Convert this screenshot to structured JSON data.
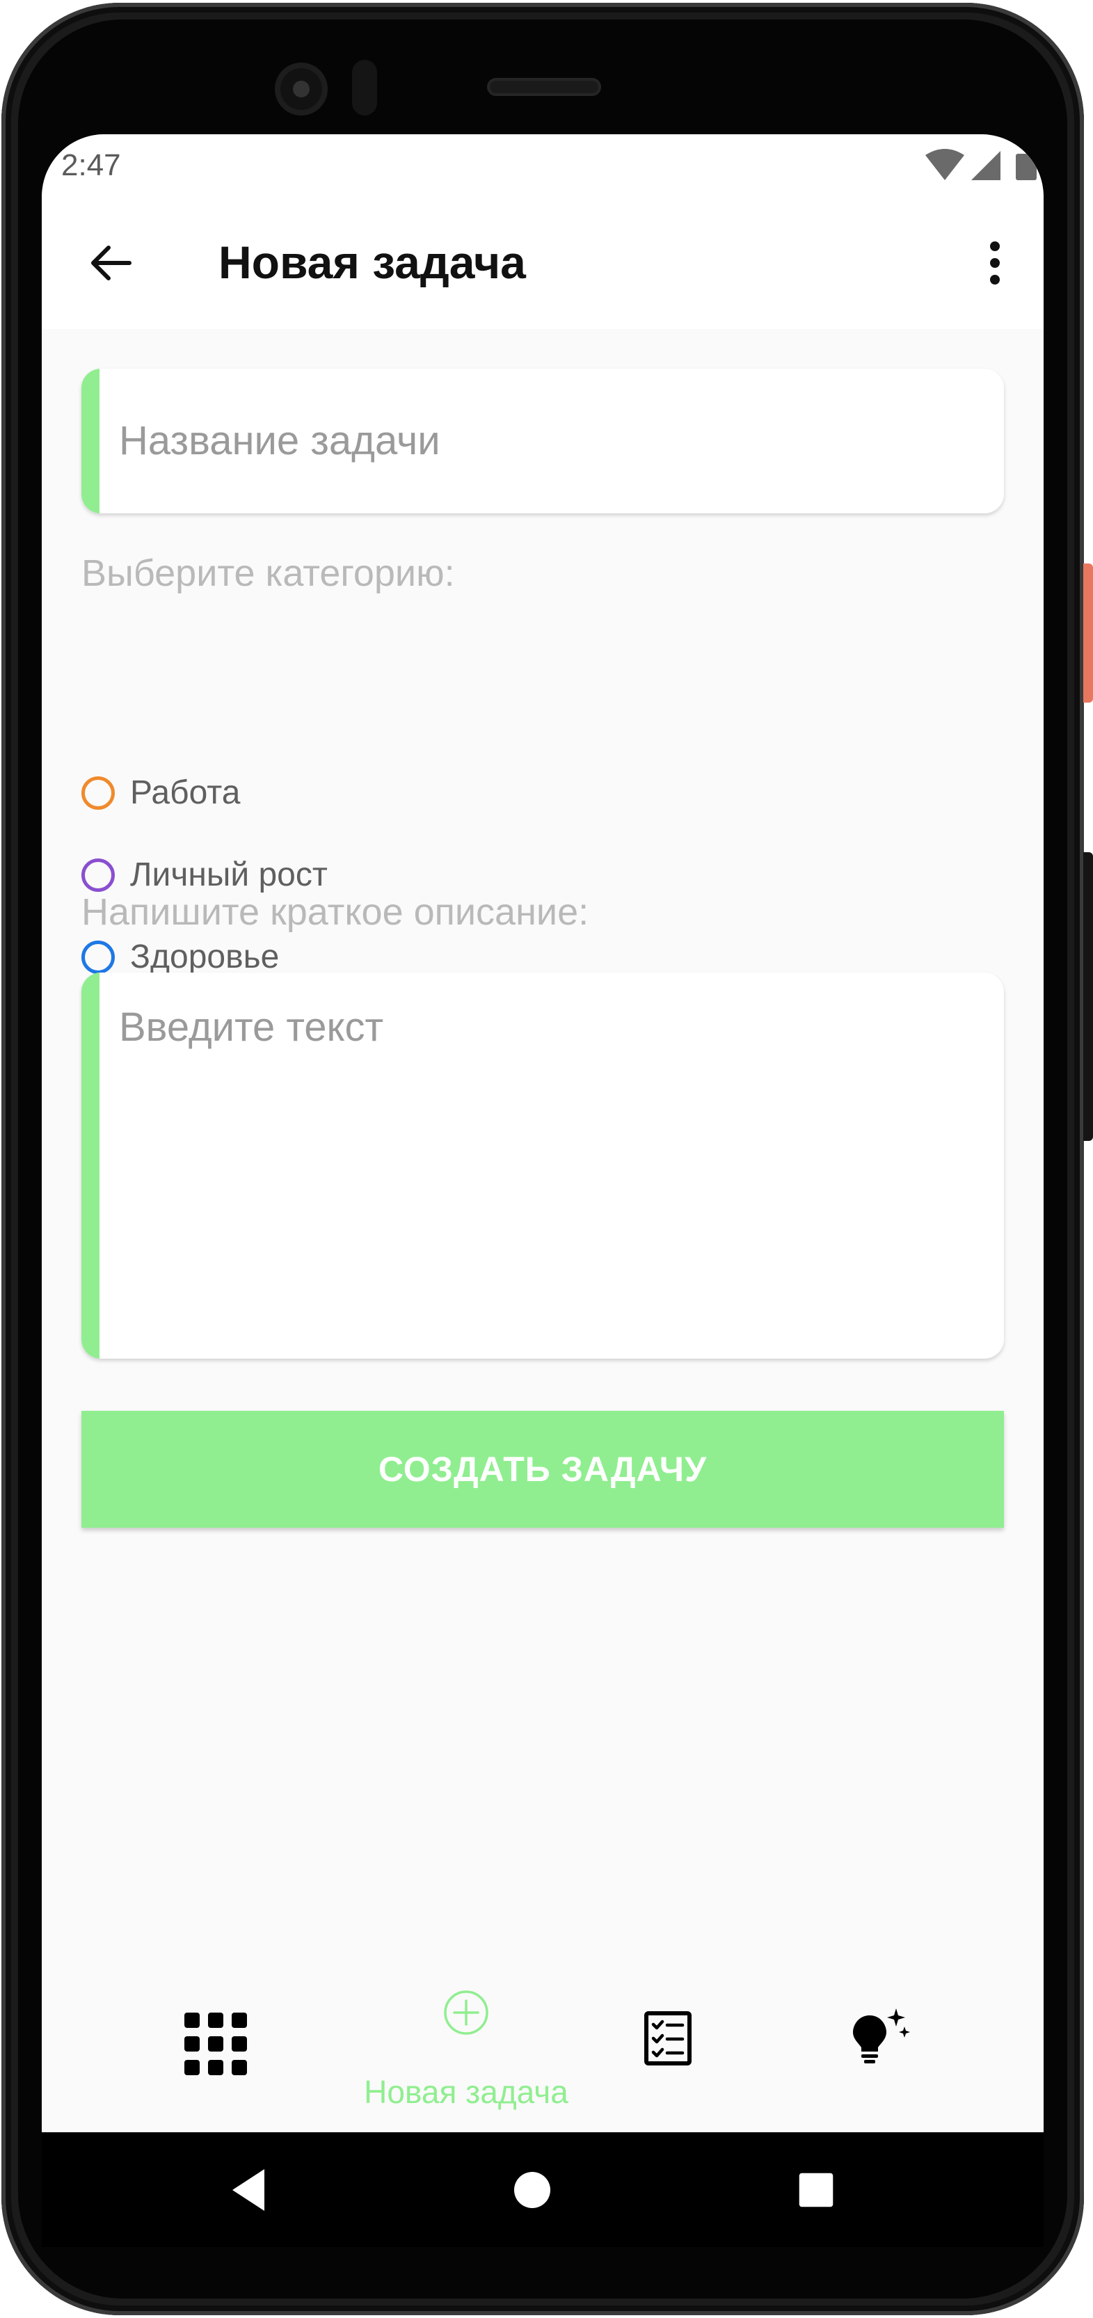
{
  "status_bar": {
    "time": "2:47"
  },
  "header": {
    "title": "Новая задача"
  },
  "form": {
    "title_placeholder": "Название задачи",
    "category_label": "Выберите категорию:",
    "categories": [
      {
        "label": "Работа",
        "color": "#f08a2c"
      },
      {
        "label": "Личный рост",
        "color": "#8a4fd0"
      },
      {
        "label": "Здоровье",
        "color": "#1e78e6"
      }
    ],
    "description_label": "Напишите краткое описание:",
    "description_placeholder": "Введите текст",
    "submit_label": "СОЗДАТЬ ЗАДАЧУ"
  },
  "bottom_nav": {
    "items": [
      {
        "icon": "grid-icon"
      },
      {
        "icon": "plus-circle-icon",
        "label": "Новая задача",
        "active": true
      },
      {
        "icon": "checklist-icon"
      },
      {
        "icon": "lightbulb-sparkle-icon"
      }
    ]
  },
  "colors": {
    "accent": "#90ee90",
    "button_text": "#ffffff"
  }
}
